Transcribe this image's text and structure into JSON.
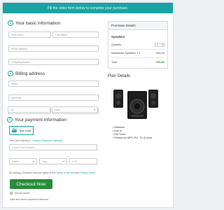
{
  "banner": "Fill the order form below to complete your purchase.",
  "sections": {
    "basic": {
      "num": "1",
      "title": "Your basic information"
    },
    "billing": {
      "num": "2",
      "title": "Billing address"
    },
    "payment": {
      "num": "3",
      "title": "Your payment information"
    }
  },
  "basic_fields": {
    "first_name": "First Name",
    "last_name": "Last Name",
    "email": "Email Address",
    "company": "Company Name"
  },
  "billing_fields": {
    "street": "Street",
    "apt": "Apt/Suite",
    "city": "City",
    "country": "Country",
    "zip": "Zip",
    "state": "State"
  },
  "payment": {
    "option_label": "Test Card",
    "card_handler_prefix": "Test Card Handlers - ",
    "card_handler_link": "Connect Payment Gateway",
    "card_number": "Credit Card Number",
    "month": "Month",
    "year": "Year",
    "cvc": "CVC"
  },
  "terms": {
    "prefix": "By clicking Checkout Now you agree to the ",
    "terms_link": "Terms of Service",
    "and": " and ",
    "privacy_link": "Privacy Policy"
  },
  "checkout_button": "Checkout Now",
  "secure_label": "Secure server",
  "safe_label": "Safe and secure payment checkout",
  "purchase_details": {
    "title": "Purchase Details",
    "product_name": "Speakers",
    "quantity_label": "Quantity",
    "quantity_value": "1",
    "line_item": "Multimedia Speakers x 1",
    "line_price": "$30.00",
    "total_label": "Total",
    "total_value": "$30.00"
  },
  "plan_details": {
    "title": "Plan Details",
    "features": [
      "Wireless",
      "Aux-in",
      "FM Tuner",
      "Perfect for MP3, PC, TV & more"
    ]
  },
  "colors": {
    "accent": "#1aa3a3",
    "button": "#2a8c3a"
  }
}
